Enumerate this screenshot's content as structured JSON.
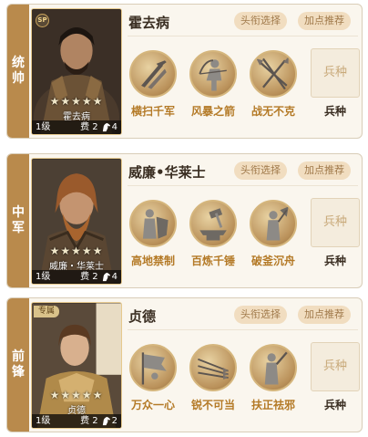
{
  "generals": [
    {
      "role": "统帅",
      "name": "霍去病",
      "stars": "★★★★★",
      "level": "1级",
      "cost": "费 2",
      "count": "4",
      "badge": "SP",
      "title_button": "头衔选择",
      "recommend_button": "加点推荐",
      "skills": [
        {
          "name": "横扫千军",
          "icon": "blades-icon"
        },
        {
          "name": "风暴之箭",
          "icon": "archer-icon"
        },
        {
          "name": "战无不克",
          "icon": "spears-icon"
        }
      ],
      "troop_slot": "兵种",
      "troop_label": "兵种"
    },
    {
      "role": "中军",
      "name": "威廉•华莱士",
      "stars": "★★★★★",
      "level": "1级",
      "cost": "费 2",
      "count": "4",
      "portrait_name": "威廉・华莱士",
      "title_button": "头衔选择",
      "recommend_button": "加点推荐",
      "skills": [
        {
          "name": "高地禁制",
          "icon": "shield-warrior-icon"
        },
        {
          "name": "百炼千锤",
          "icon": "hammer-anvil-icon"
        },
        {
          "name": "破釜沉舟",
          "icon": "axe-warrior-icon"
        }
      ],
      "troop_slot": "兵种",
      "troop_label": "兵种"
    },
    {
      "role": "前锋",
      "name": "贞德",
      "stars": "★★★★★",
      "level": "1级",
      "cost": "费 2",
      "count": "2",
      "badge": "专属",
      "title_button": "头衔选择",
      "recommend_button": "加点推荐",
      "skills": [
        {
          "name": "万众一心",
          "icon": "banner-icon"
        },
        {
          "name": "锐不可当",
          "icon": "arrows-icon"
        },
        {
          "name": "扶正祛邪",
          "icon": "knight-icon"
        }
      ],
      "troop_slot": "兵种",
      "troop_label": "兵种"
    }
  ]
}
